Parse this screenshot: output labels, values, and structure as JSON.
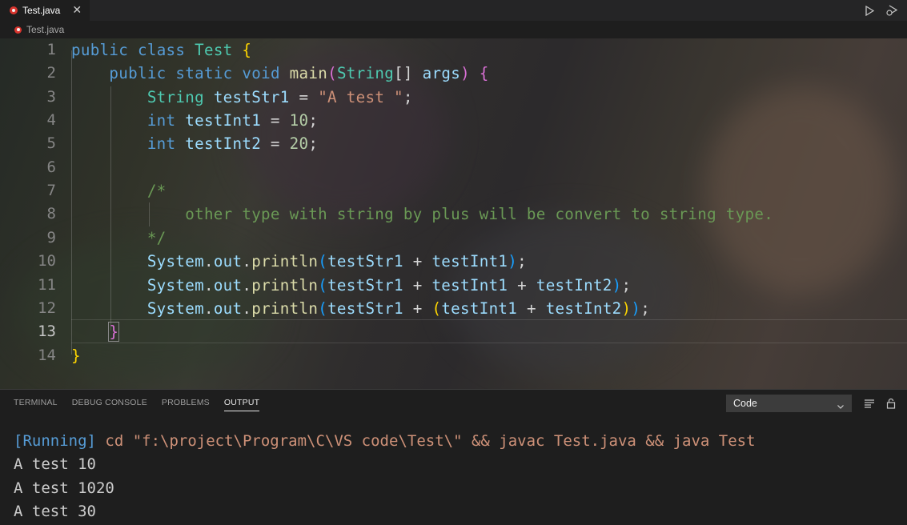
{
  "tab": {
    "label": "Test.java",
    "close": "✕"
  },
  "breadcrumb": {
    "label": "Test.java"
  },
  "editor": {
    "line_numbers": [
      "1",
      "2",
      "3",
      "4",
      "5",
      "6",
      "7",
      "8",
      "9",
      "10",
      "11",
      "12",
      "13",
      "14"
    ],
    "active_line": "13"
  },
  "panel": {
    "tabs": [
      "TERMINAL",
      "DEBUG CONSOLE",
      "PROBLEMS",
      "OUTPUT"
    ],
    "active_tab": "OUTPUT",
    "output_channel": "Code",
    "output": {
      "running_tag": "[Running]",
      "command": " cd \"f:\\project\\Program\\C\\VS code\\Test\\\" && javac Test.java && java Test",
      "lines": [
        "A test 10",
        "A test 1020",
        "A test 30"
      ]
    }
  },
  "icons": {
    "run": "play-icon",
    "debug": "debug-run-icon",
    "java": "java-file-icon",
    "lines": "word-wrap-icon",
    "lock": "lock-icon"
  },
  "colors": {
    "keyword": "#569cd6",
    "type": "#4ec9b0",
    "function": "#dcdcaa",
    "variable": "#9cdcfe",
    "string": "#ce9178",
    "number": "#b5cea8",
    "comment": "#6a9955"
  }
}
